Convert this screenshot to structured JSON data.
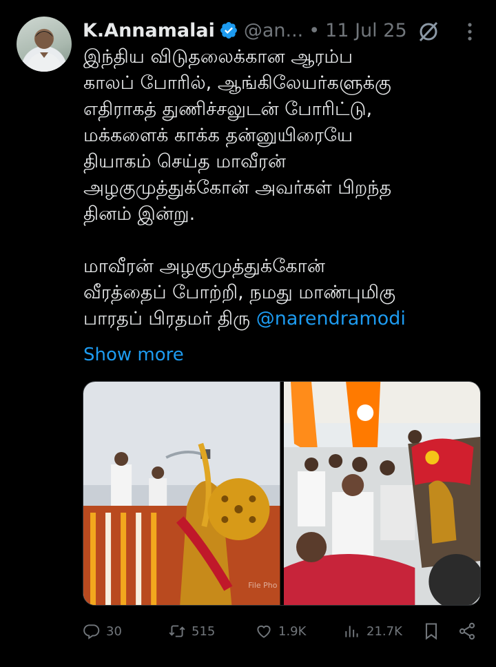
{
  "author": {
    "name": "K.Annamalai",
    "handle": "@an...",
    "separator": "•",
    "date": "11 Jul 25"
  },
  "body": {
    "lines": [
      "இந்திய விடுதலைக்கான ஆரம்ப",
      "காலப் போரில், ஆங்கிலேயர்களுக்கு",
      "எதிராகத் துணிச்சலுடன் போரிட்டு,",
      "மக்களைக் காக்க தன்னுயிரையே",
      "தியாகம் செய்த மாவீரன்",
      "அழகுமுத்துக்கோன் அவர்கள் பிறந்த",
      "தினம் இன்று."
    ],
    "lines2": [
      "மாவீரன் அழகுமுத்துக்கோன்",
      "வீரத்தைப் போற்றி, நமது மாண்புமிகு"
    ],
    "last_line_prefix": "பாரதப் பிரதமர் திரு ",
    "mention": "@narendramodi",
    "show_more": "Show more"
  },
  "media": {
    "watermark": "File Pho"
  },
  "actions": {
    "replies": "30",
    "reposts": "515",
    "likes": "1.9K",
    "views": "21.7K"
  },
  "icons": [
    "verified-icon",
    "grok-icon",
    "more-icon",
    "reply-icon",
    "repost-icon",
    "like-icon",
    "views-icon",
    "bookmark-icon",
    "share-icon"
  ],
  "colors": {
    "accent": "#1d9bf0",
    "muted": "#71767b",
    "text": "#e7e9ea",
    "background": "#000000"
  }
}
